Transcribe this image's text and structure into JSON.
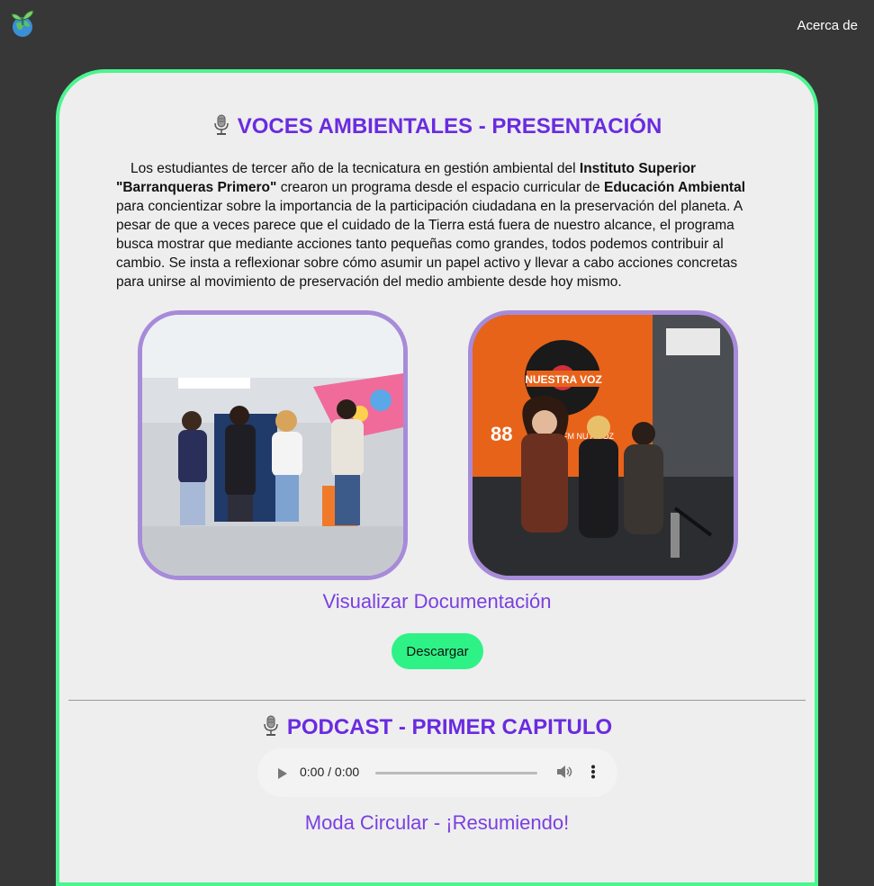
{
  "nav": {
    "about_label": "Acerca de"
  },
  "section1": {
    "title": "VOCES AMBIENTALES - PRESENTACIÓN",
    "intro_1": "Los estudiantes de tercer año de la tecnicatura en gestión ambiental del ",
    "intro_bold_1": "Instituto Superior \"Barranqueras Primero\"",
    "intro_2": " crearon un programa desde el espacio curricular de ",
    "intro_bold_2": "Educación Ambiental",
    "intro_3": " para concientizar sobre la importancia de la participación ciudadana en la preservación del planeta. A pesar de que a veces parece que el cuidado de la Tierra está fuera de nuestro alcance, el programa busca mostrar que mediante acciones tanto pequeñas como grandes, todos podemos contribuir al cambio. Se insta a reflexionar sobre cómo asumir un papel activo y llevar a cabo acciones concretas para unirse al movimiento de preservación del medio ambiente desde hoy mismo.",
    "doc_link": "Visualizar Documentación",
    "download_label": "Descargar",
    "photo2_sign": "NUESTRA VOZ",
    "photo2_freq": "88",
    "photo2_fm": "FM NU    A VOZ"
  },
  "section2": {
    "title": "PODCAST - PRIMER CAPITULO",
    "audio_time": "0:00 / 0:00",
    "audio_progress": 0,
    "episode_link": "Moda Circular - ¡Resumiendo!"
  },
  "colors": {
    "accent_purple": "#6a2be0",
    "card_border": "#4cf58f",
    "button_green": "#2ef286",
    "photo_border": "#a78bd9",
    "page_bg": "#373737"
  },
  "icons": [
    "logo-icon",
    "microphone-icon",
    "play-icon",
    "volume-icon",
    "more-options-icon"
  ]
}
